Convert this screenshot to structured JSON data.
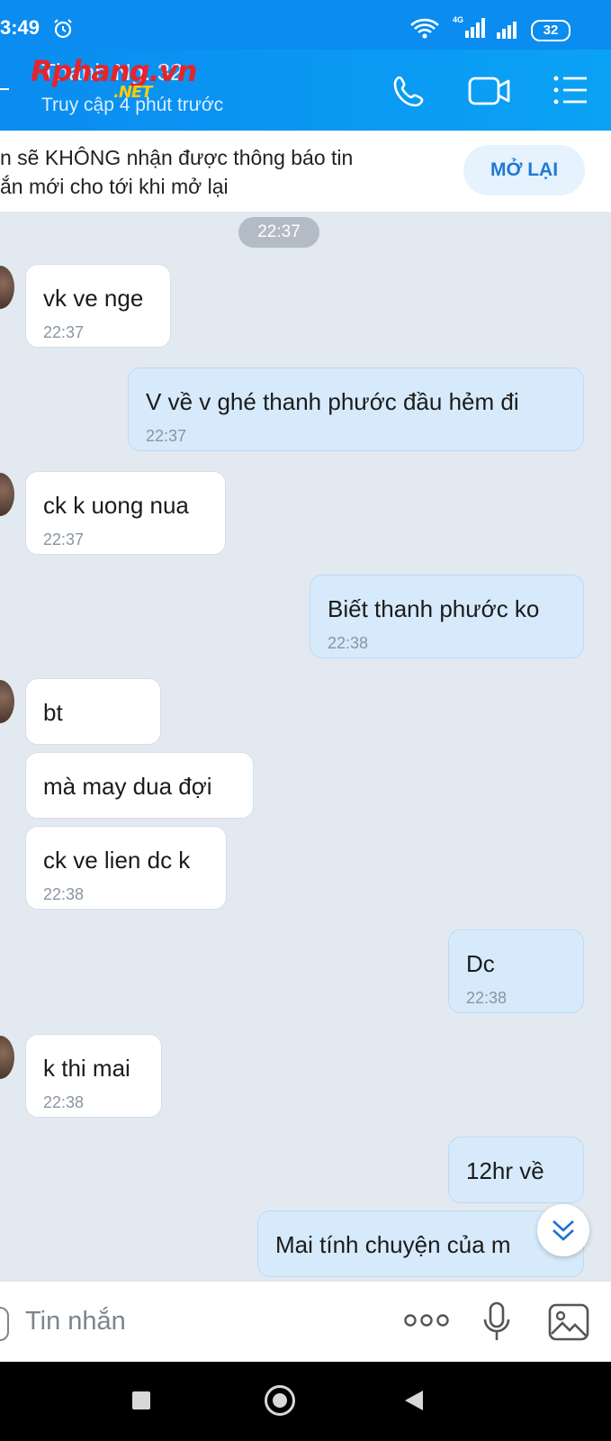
{
  "status_bar": {
    "time": "3:49",
    "network_label": "4G",
    "battery": "32"
  },
  "header": {
    "contact_name": "Thanh Ng..32",
    "subtitle": "Truy cập 4 phút trước"
  },
  "watermark": {
    "brand_main": "Rphang.vn",
    "brand_sub": ".NET"
  },
  "notice": {
    "text_line1": "n sẽ KHÔNG nhận được thông báo tin",
    "text_line2": "ắn mới cho tới khi mở lại",
    "button_label": "MỞ LẠI"
  },
  "date_chip": "22:37",
  "messages": [
    {
      "text": "vk ve nge",
      "time": "22:37"
    },
    {
      "text": "V về v ghé thanh phước đầu hẻm đi",
      "time": "22:37"
    },
    {
      "text": "ck k uong nua",
      "time": "22:37"
    },
    {
      "text": "Biết thanh phước ko",
      "time": "22:38"
    },
    {
      "text": "bt"
    },
    {
      "text": "mà may dua đợi"
    },
    {
      "text": "ck ve lien dc k",
      "time": "22:38"
    },
    {
      "text": "Dc",
      "time": "22:38"
    },
    {
      "text": "k thi mai",
      "time": "22:38"
    },
    {
      "text": "12hr về"
    },
    {
      "text": "Mai tính chuyện của m"
    }
  ],
  "composer": {
    "placeholder": "Tin nhắn"
  },
  "icons": [
    "alarm-icon",
    "wifi-icon",
    "signal-icon",
    "battery-icon",
    "phone-icon",
    "video-call-icon",
    "menu-icon",
    "scroll-down-icon",
    "more-icon",
    "microphone-icon",
    "image-icon",
    "recent-apps-icon",
    "home-icon",
    "back-icon"
  ]
}
